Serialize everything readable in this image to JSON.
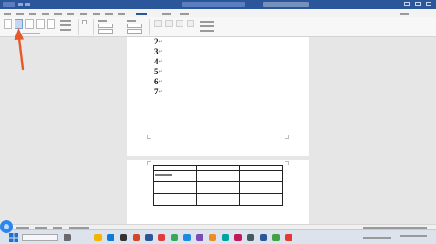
{
  "numbered_lines": [
    "2",
    "3",
    "4",
    "5",
    "6",
    "7"
  ],
  "colors": {
    "title_bar": "#2b579a",
    "arrow": "#e8582a",
    "help_bubble": "#2e86e8"
  },
  "icons": {
    "help": "help-circle-icon",
    "arrow": "red-arrow-annotation-icon"
  }
}
